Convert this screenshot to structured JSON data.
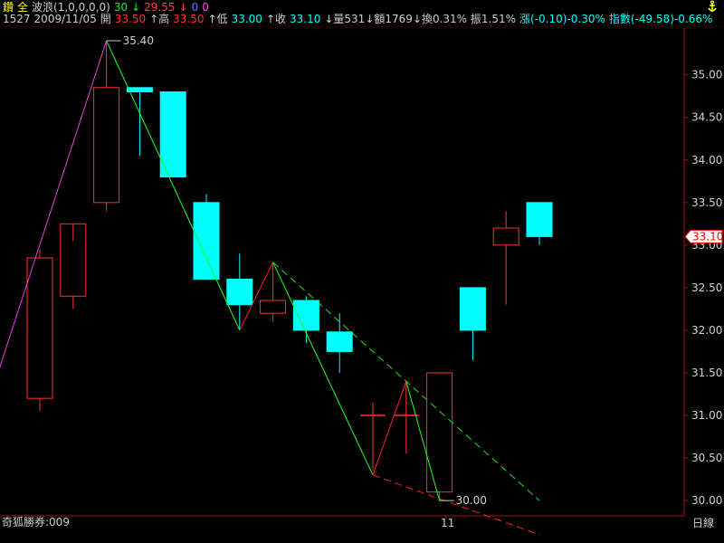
{
  "header": {
    "row1": [
      {
        "text": "鑽",
        "color": "#ffff00"
      },
      {
        "text": "全",
        "color": "#ffff00"
      },
      {
        "text": "波浪(1,0,0,0,0)",
        "color": "#cccccc"
      },
      {
        "text": "30",
        "color": "#00ff00"
      },
      {
        "text": "↓",
        "color": "#00ff00"
      },
      {
        "text": "29.55",
        "color": "#ff4040"
      },
      {
        "text": "↓",
        "color": "#ff4040"
      },
      {
        "text": "0",
        "color": "#7070ff"
      },
      {
        "text": "0",
        "color": "#ff40ff"
      }
    ],
    "row2": [
      {
        "text": "1527",
        "color": "#cccccc"
      },
      {
        "text": "2009/11/05",
        "color": "#cccccc"
      },
      {
        "text": "開",
        "color": "#cccccc"
      },
      {
        "text": "33.50",
        "color": "#ff3030"
      },
      {
        "text": "↑高",
        "color": "#cccccc"
      },
      {
        "text": "33.50",
        "color": "#ff3030"
      },
      {
        "text": "↑低",
        "color": "#cccccc"
      },
      {
        "text": "33.00",
        "color": "#00ffff"
      },
      {
        "text": "↑收",
        "color": "#cccccc"
      },
      {
        "text": "33.10",
        "color": "#00ffff"
      },
      {
        "text": "↓量531↓額1769↓換0.31% 振1.51%",
        "color": "#cccccc"
      },
      {
        "text": "漲(-0.10)-0.30%",
        "color": "#00ffff"
      },
      {
        "text": "指數(-49.58)-0.66%",
        "color": "#00ffff"
      }
    ],
    "corner_icon": "anchor-icon",
    "corner_icon_color": "#ffff00"
  },
  "footer": {
    "left_label": "奇狐勝券:009",
    "x_tick_label": "11",
    "right_label": "日線"
  },
  "chart_data": {
    "type": "candlestick",
    "ylim": [
      29.82,
      35.56
    ],
    "y_ticks": [
      "30.00",
      "30.50",
      "31.00",
      "31.50",
      "32.00",
      "32.50",
      "33.00",
      "33.50",
      "34.00",
      "34.50",
      "35.00"
    ],
    "last_price_label": "33.10",
    "annotations": [
      {
        "text": "35.40",
        "value": 35.4,
        "bar": 3
      },
      {
        "text": "30.00",
        "value": 30.0,
        "bar": 13
      }
    ],
    "colors": {
      "up": "#ff3030",
      "down": "#00ffff",
      "axis": "#a01010",
      "wave_up": "#ff2020",
      "wave_down": "#20ff20",
      "wave_first": "#e040e0",
      "channel_upper": "#20e020",
      "channel_lower": "#ff2020",
      "tag_bg": "#ffffff",
      "tag_border": "#ff0000",
      "tag_text": "#ff0000"
    },
    "candles": [
      {
        "open": 31.2,
        "high": 32.95,
        "low": 31.05,
        "close": 32.85
      },
      {
        "open": 32.4,
        "high": 33.05,
        "low": 32.25,
        "close": 33.25
      },
      {
        "open": 33.5,
        "high": 35.4,
        "low": 33.4,
        "close": 34.85
      },
      {
        "open": 34.85,
        "high": 34.85,
        "low": 34.05,
        "close": 34.8
      },
      {
        "open": 34.8,
        "high": 34.8,
        "low": 33.8,
        "close": 33.8
      },
      {
        "open": 33.5,
        "high": 33.6,
        "low": 32.6,
        "close": 32.6
      },
      {
        "open": 32.6,
        "high": 32.9,
        "low": 32.0,
        "close": 32.3
      },
      {
        "open": 32.2,
        "high": 32.8,
        "low": 32.1,
        "close": 32.35
      },
      {
        "open": 32.35,
        "high": 32.4,
        "low": 31.85,
        "close": 32.0
      },
      {
        "open": 31.98,
        "high": 32.2,
        "low": 31.5,
        "close": 31.75
      },
      {
        "open": 31.0,
        "high": 31.15,
        "low": 30.35,
        "close": 31.0
      },
      {
        "open": 31.0,
        "high": 31.4,
        "low": 30.55,
        "close": 31.0
      },
      {
        "open": 30.1,
        "high": 31.5,
        "low": 30.0,
        "close": 31.5
      },
      {
        "open": 32.5,
        "high": 32.5,
        "low": 31.65,
        "close": 32.0
      },
      {
        "open": 33.0,
        "high": 33.4,
        "low": 32.3,
        "close": 33.2
      },
      {
        "open": 33.5,
        "high": 33.5,
        "low": 33.0,
        "close": 33.1
      }
    ],
    "wave_points": [
      {
        "bar": -0.55,
        "value": 31.15
      },
      {
        "bar": 3,
        "value": 35.4
      },
      {
        "bar": 7,
        "value": 32.0
      },
      {
        "bar": 8,
        "value": 32.8
      },
      {
        "bar": 11,
        "value": 30.3
      },
      {
        "bar": 12,
        "value": 31.4
      },
      {
        "bar": 13,
        "value": 30.0
      }
    ],
    "channel_lines": [
      {
        "from": {
          "bar": 8,
          "value": 32.8
        },
        "to": {
          "bar": 16,
          "value": 30.0
        },
        "style": "upper"
      },
      {
        "from": {
          "bar": 11,
          "value": 30.3
        },
        "to": {
          "bar": 16,
          "value": 29.6
        },
        "style": "lower"
      }
    ]
  }
}
